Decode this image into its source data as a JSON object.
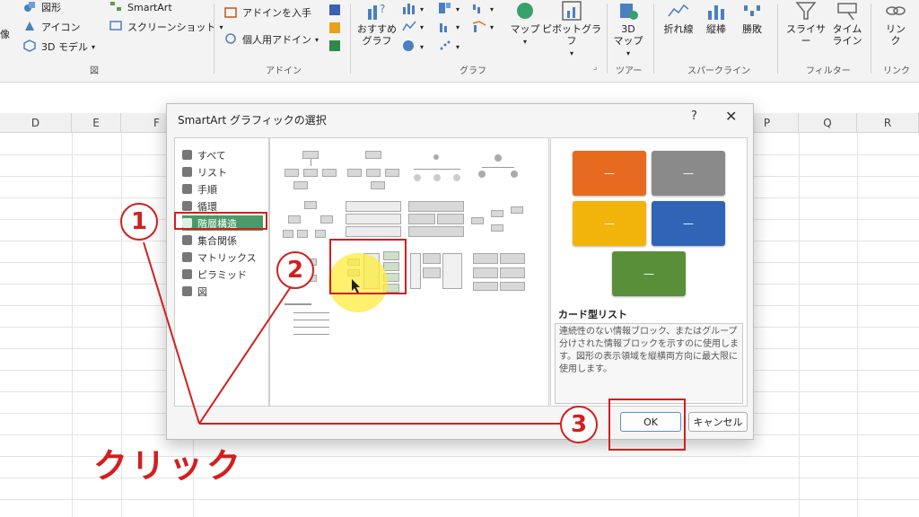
{
  "ribbon": {
    "insert_left": {
      "image_label": "像",
      "shapes_label": "図形",
      "icons_label": "アイコン",
      "model3d_label": "3D モデル",
      "smartart_label": "SmartArt",
      "screenshot_label": "スクリーンショット",
      "group_label": "図"
    },
    "addins": {
      "get_label": "アドインを入手",
      "personal_label": "個人用アドイン",
      "group_label": "アドイン"
    },
    "charts": {
      "recommended_label": "おすすめ\nグラフ",
      "maps_label": "マップ",
      "pivot_label": "ピボットグラフ",
      "group_label": "グラフ"
    },
    "tours": {
      "map3d_label": "3D\nマップ",
      "group_label": "ツアー"
    },
    "sparklines": {
      "line_label": "折れ線",
      "column_label": "縦棒",
      "winloss_label": "勝敗",
      "group_label": "スパークライン"
    },
    "filters": {
      "slicer_label": "スライサー",
      "timeline_label": "タイム\nライン",
      "group_label": "フィルター"
    },
    "links": {
      "link_label": "リン\nク",
      "group_label": "リンク"
    }
  },
  "sheet": {
    "columns": [
      "D",
      "E",
      "F",
      "P",
      "Q",
      "R"
    ]
  },
  "dialog": {
    "title": "SmartArt グラフィックの選択",
    "help": "?",
    "close": "✕",
    "categories": [
      {
        "label": "すべて",
        "icon": "all-icon"
      },
      {
        "label": "リスト",
        "icon": "list-icon"
      },
      {
        "label": "手順",
        "icon": "process-icon"
      },
      {
        "label": "循環",
        "icon": "cycle-icon"
      },
      {
        "label": "階層構造",
        "icon": "hierarchy-icon"
      },
      {
        "label": "集合関係",
        "icon": "relationship-icon"
      },
      {
        "label": "マトリックス",
        "icon": "matrix-icon"
      },
      {
        "label": "ピラミッド",
        "icon": "pyramid-icon"
      },
      {
        "label": "図",
        "icon": "picture-icon"
      }
    ],
    "selected_category": "階層構造",
    "preview": {
      "title": "カード型リスト",
      "description": "連続性のない情報ブロック、またはグループ分けされた情報ブロックを示すのに使用します。図形の表示領域を縦横両方向に最大限に使用します。",
      "colors": [
        "#e66a1f",
        "#8a8a8a",
        "#f2b40b",
        "#2f64b6",
        "#5a8f3a"
      ],
      "box_text": "—"
    },
    "ok_label": "OK",
    "cancel_label": "キャンセル"
  },
  "annotations": {
    "badge1": "1",
    "badge2": "2",
    "badge3": "3",
    "click_text": "クリック",
    "accent": "#d21f1f"
  }
}
